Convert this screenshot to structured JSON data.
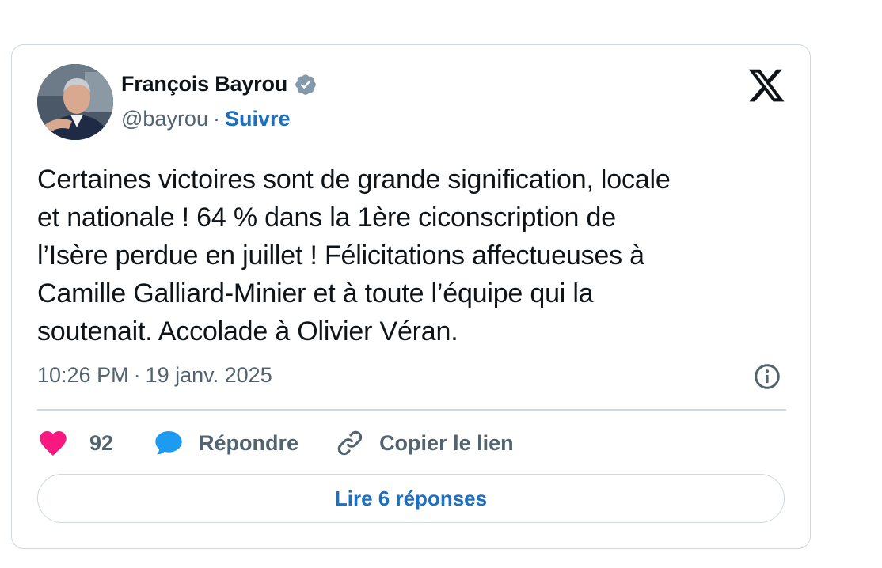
{
  "author": {
    "name": "François Bayrou",
    "handle": "@bayrou",
    "separator": "·",
    "follow_label": "Suivre"
  },
  "tweet": {
    "text": "Certaines victoires sont de grande signification, locale\net nationale ! 64 % dans la 1ère ciconscription de\nl’Isère perdue en juillet ! Félicitations affectueuses à\nCamille Galliard-Minier et à toute l’équipe qui la\nsoutenait. Accolade à Olivier Véran.",
    "time": "10:26 PM",
    "separator": "·",
    "date": "19 janv. 2025"
  },
  "actions": {
    "like_count": "92",
    "reply_label": "Répondre",
    "copy_link_label": "Copier le lien"
  },
  "read_replies_label": "Lire 6 réponses",
  "icons": {
    "verified": "verified-badge-icon",
    "logo": "x-logo-icon",
    "info": "info-icon",
    "like": "heart-icon",
    "reply": "speech-bubble-icon",
    "link": "link-icon"
  },
  "colors": {
    "link_blue": "#1d6fc2",
    "heart_pink": "#f91880",
    "reply_blue": "#1d9bf0",
    "muted_gray": "#536471",
    "border": "#cfd9de"
  }
}
